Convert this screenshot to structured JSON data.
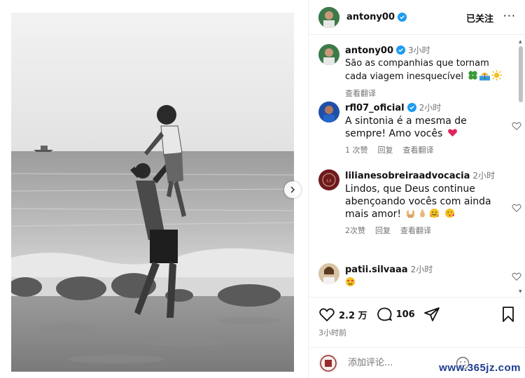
{
  "header": {
    "username": "antony00",
    "follow_status": "已关注",
    "more_label": "···"
  },
  "comments": [
    {
      "username": "antony00",
      "time": "3小时",
      "text": "São as companhias que tornam cada viagem inesquecível",
      "emojis": [
        "four-leaf-clover",
        "beach-umbrella",
        "sun"
      ],
      "translate": "查看翻译",
      "verified": true
    },
    {
      "username": "rfl07_oficial",
      "time": "2小时",
      "text": "A sintonia é a mesma de sempre! Amo vocês",
      "emojis": [
        "red-heart"
      ],
      "likes": "1 次赞",
      "reply": "回复",
      "translate": "查看翻译",
      "verified": true
    },
    {
      "username": "lilianesobreiraadvocacia",
      "time": "2小时",
      "text": "Lindos, que Deus continue abençoando vocês com ainda mais amor!",
      "emojis": [
        "raising-hands",
        "folded-hands",
        "hugging-face",
        "face-blowing-kiss"
      ],
      "likes": "2次赞",
      "reply": "回复",
      "translate": "查看翻译",
      "verified": false
    },
    {
      "username": "patii.silvaaa",
      "time": "2小时",
      "text": "",
      "emojis": [
        "heart-eyes-face"
      ],
      "verified": false
    }
  ],
  "actions": {
    "likes": "2.2 万",
    "comments": "106",
    "post_time": "3小时前"
  },
  "comment_box": {
    "placeholder": "添加评论..."
  },
  "watermark": "www.365jz.com",
  "colors": {
    "verified": "#1d9bf0",
    "secondary_text": "#737373",
    "heart_red": "#e0245e"
  }
}
